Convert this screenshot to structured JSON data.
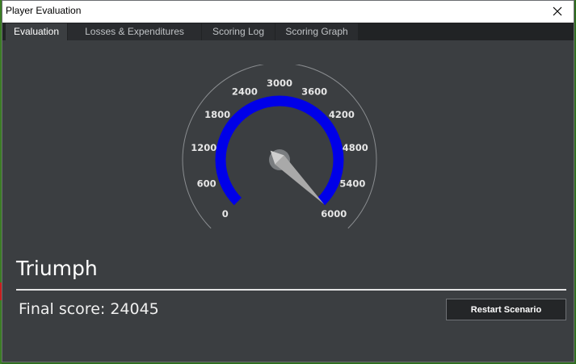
{
  "window": {
    "title": "Player Evaluation"
  },
  "tabs": [
    {
      "label": "Evaluation",
      "active": true
    },
    {
      "label": "Losses & Expenditures",
      "active": false
    },
    {
      "label": "Scoring Log",
      "active": false
    },
    {
      "label": "Scoring Graph",
      "active": false
    }
  ],
  "gauge": {
    "min": 0,
    "max": 6000,
    "tick_labels": [
      "0",
      "600",
      "1200",
      "1800",
      "2400",
      "3000",
      "3600",
      "4200",
      "4800",
      "5400",
      "6000"
    ],
    "needle_value": 6000,
    "band_color": "#0000e8",
    "needle_color": "#a9a9a9"
  },
  "result": {
    "title": "Triumph",
    "final_score_label": "Final score: 24045"
  },
  "buttons": {
    "restart_label": "Restart Scenario"
  }
}
